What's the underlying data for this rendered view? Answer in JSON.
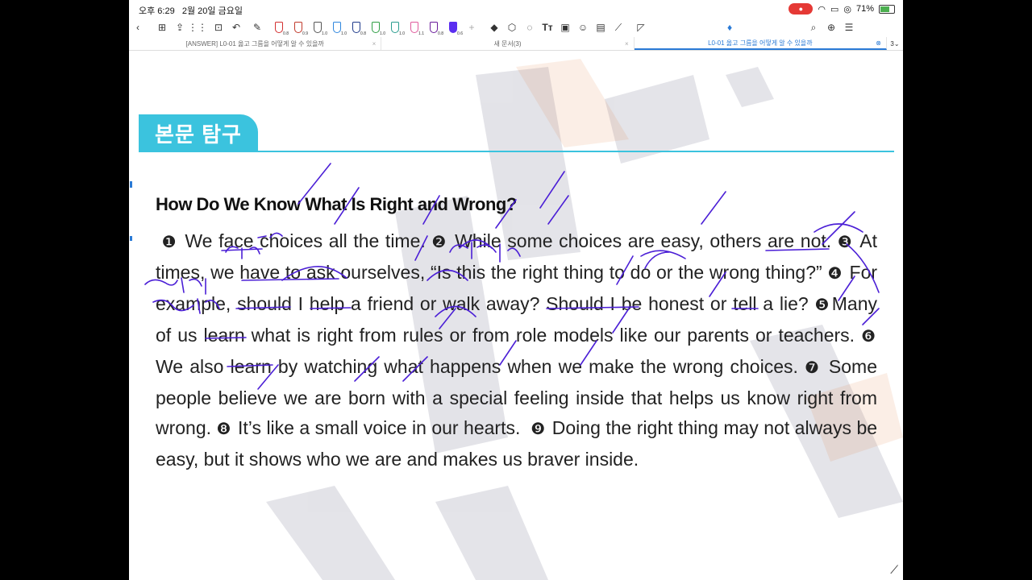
{
  "status": {
    "time": "오후 6:29",
    "date": "2월 20일 금요일",
    "battery": "71%",
    "battery_level": 0.71
  },
  "toolbar": {
    "pens": [
      {
        "icon": "pen-icon",
        "color": "#d32f2f",
        "size": "0.8"
      },
      {
        "icon": "pen-icon",
        "color": "#c0392b",
        "size": "0.9"
      },
      {
        "icon": "pen-icon",
        "color": "#555555",
        "size": "1.0"
      },
      {
        "icon": "pen-icon",
        "color": "#2e86de",
        "size": "1.0"
      },
      {
        "icon": "pen-icon",
        "color": "#1e3a8a",
        "size": "0.8"
      },
      {
        "icon": "pen-icon",
        "color": "#2e9e44",
        "size": "1.0"
      },
      {
        "icon": "pen-icon",
        "color": "#2a9d8f",
        "size": "1.0"
      },
      {
        "icon": "pen-icon",
        "color": "#e05a9c",
        "size": "1.1"
      },
      {
        "icon": "pen-icon",
        "color": "#6a1b9a",
        "size": "0.8"
      },
      {
        "icon": "pen-icon",
        "color": "#5b2ef0",
        "size": "0.6"
      }
    ]
  },
  "tabs": [
    {
      "label": "[ANSWER] L0-01 옳고 그름을 어떻게 알 수 있을까",
      "active": false
    },
    {
      "label": "새 문서(3)",
      "active": false
    },
    {
      "label": "L0-01 옳고 그름을 어떻게 알 수 있을까",
      "active": true
    }
  ],
  "tab_count": "3",
  "document": {
    "section_title": "본문 탐구",
    "title": "How Do We Know What Is Right and Wrong?",
    "sentences": [
      {
        "num": "❶",
        "text": "We face choices all the time."
      },
      {
        "num": "❷",
        "text": "While some choices are easy, others are not."
      },
      {
        "num": "❸",
        "text": "At times, we have to ask ourselves, “Is this the right thing to do or the wrong thing?”"
      },
      {
        "num": "❹",
        "text": "For example, should I help a friend or walk away? Should I be honest or tell a lie?"
      },
      {
        "num": "❺",
        "text": "Many of us learn what is right from rules or from role models like our parents or teachers."
      },
      {
        "num": "❻",
        "text": "We also learn by watching what happens when we make the wrong choices."
      },
      {
        "num": "❼",
        "text": "Some people believe we are born with a special feeling inside that helps us know right from wrong."
      },
      {
        "num": "❽",
        "text": "It’s like a small voice in our hearts."
      },
      {
        "num": "❾",
        "text": "Doing the right thing may not always be easy, but it shows who we are and makes us braver inside."
      }
    ]
  },
  "colors": {
    "accent": "#3bc3de",
    "ink": "#4b1fd6",
    "active_tab": "#2a7ad6"
  }
}
